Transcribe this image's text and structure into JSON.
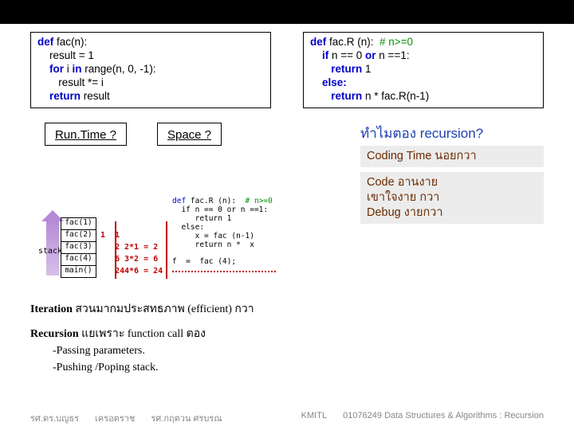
{
  "code_left": {
    "l1a": "def",
    "l1b": " fac(n):",
    "l2": "    result = 1",
    "l3a": "    for",
    "l3b": " i ",
    "l3c": "in",
    "l3d": " range(n, 0, -1):",
    "l4": "       result *= i",
    "l5a": "    return",
    "l5b": " result"
  },
  "code_right": {
    "l1a": "def",
    "l1b": " fac.R (n):  ",
    "l1c": "# n>=0",
    "l2a": "    if",
    "l2b": " n == 0 ",
    "l2c": "or",
    "l2d": " n ==1:",
    "l3a": "       return",
    "l3b": " 1",
    "l4a": "    else:",
    "l5a": "       return",
    "l5b": " n * fac.R(n-1)"
  },
  "runtime_label": "Run.Time ?",
  "space_label": "Space ?",
  "why_title": "ทำไมตอง recursion?",
  "benefit1": "Coding Time นอยกวา",
  "benefit2_l1": "Code อานงาย",
  "benefit2_l2": "เขาใจงาย    กวา",
  "benefit2_l3": "Debug งายกวา",
  "dg_code": {
    "l1a": "def",
    "l1b": " fac.R (n):  ",
    "l1c": "# n>=0",
    "l2": "  if n == 0 or n ==1:",
    "l3": "     return 1",
    "l4": "  else:",
    "l5": "     x = fac (n-1)",
    "l6": "     return n *  x",
    "l7": "f  =  fac (4);"
  },
  "stack": {
    "label": "stack",
    "r1": "fac(1)",
    "r2": "fac(2)",
    "r3": "fac(3)",
    "r4": "fac(4)",
    "r5": "main()"
  },
  "nums": {
    "n1": "1",
    "n2": "1",
    "n3": "2",
    "n4": "6",
    "n5": "24"
  },
  "calcs": {
    "c2": "2*1 = 2",
    "c3": "3*2 = 6",
    "c4": "4*6 = 24"
  },
  "para1a": "Iteration",
  "para1b": " สวนมากมประสทธภาพ        (efficient) กวา",
  "para2a": "Recursion",
  "para2b": " แยเพราะ   function call ตอง",
  "para2c": "        -Passing parameters.",
  "para2d": "        -Pushing /Poping stack.",
  "footer": {
    "a": "รศ.ดร.บญธร",
    "b": "เครอตราช",
    "c": "รศ.กฤตวน  ศรบรณ",
    "d": "KMITL",
    "e": "01076249 Data Structures & Algorithms : Recursion"
  }
}
